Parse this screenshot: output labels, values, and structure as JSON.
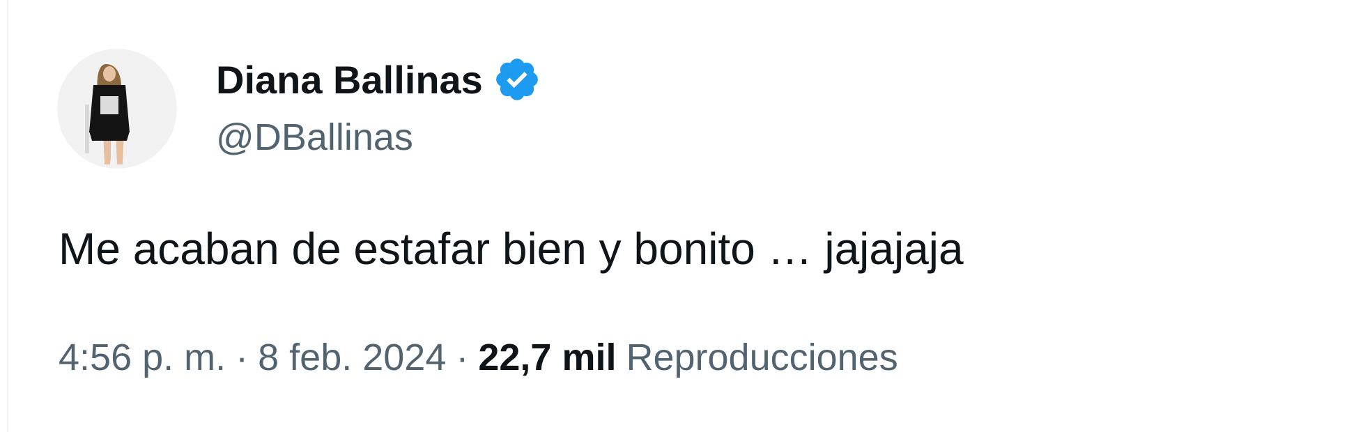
{
  "author": {
    "display_name": "Diana Ballinas",
    "handle": "@DBallinas",
    "verified": true,
    "verified_color": "#1d9bf0"
  },
  "tweet": {
    "text": "Me acaban de estafar bien y bonito … jajajaja"
  },
  "meta": {
    "time": "4:56 p. m.",
    "separator": "·",
    "date": "8 feb. 2024",
    "views_count": "22,7 mil",
    "views_label": "Reproducciones"
  },
  "icons": {
    "verified": "verified-badge-icon"
  }
}
